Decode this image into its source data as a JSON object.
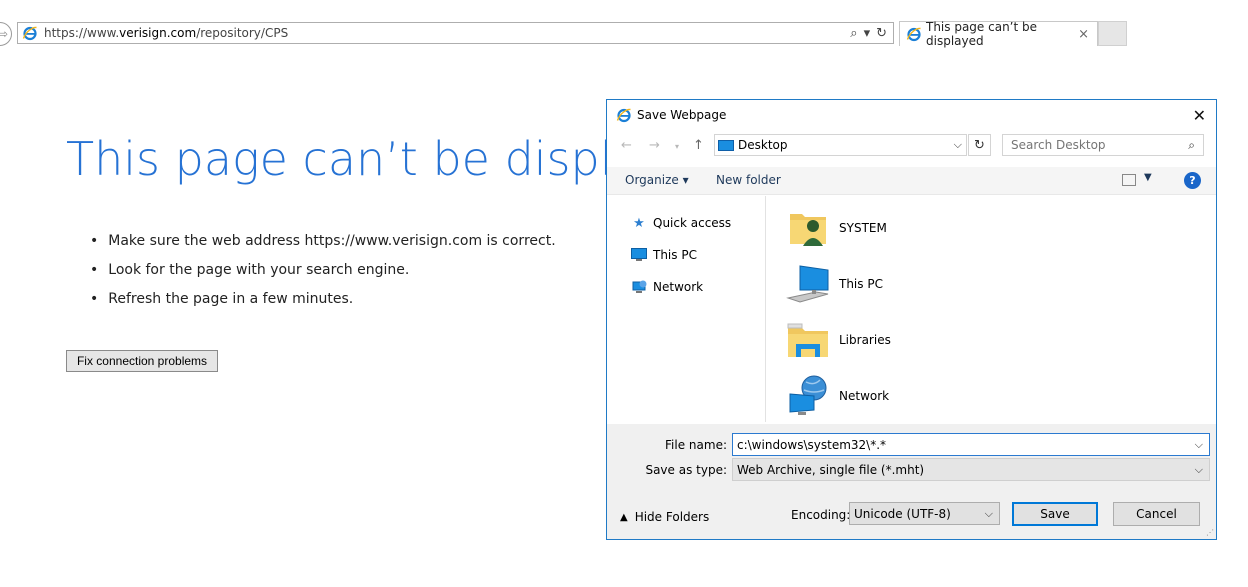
{
  "browser": {
    "address_prefix": "https://www.",
    "address_domain": "verisign.com",
    "address_suffix": "/repository/CPS",
    "search_icon": "⌕",
    "dropdown_icon": "▾",
    "refresh_icon": "↻",
    "tab_title": "This page can’t be displayed",
    "tab_close": "×"
  },
  "error_page": {
    "title": "This page can’t be displayed",
    "bullets": [
      "Make sure the web address https://www.verisign.com is correct.",
      "Look for the page with your search engine.",
      "Refresh the page in a few minutes."
    ],
    "fix_button": "Fix connection problems"
  },
  "dialog": {
    "title": "Save Webpage",
    "close": "✕",
    "location": "Desktop",
    "search_placeholder": "Search Desktop",
    "organize": "Organize ▾",
    "new_folder": "New folder",
    "help": "?",
    "nav_items": [
      {
        "label": "Quick access",
        "icon": "star-icon"
      },
      {
        "label": "This PC",
        "icon": "computer-icon"
      },
      {
        "label": "Network",
        "icon": "network-icon"
      }
    ],
    "items": [
      {
        "label": "SYSTEM",
        "icon": "user-folder-icon"
      },
      {
        "label": "This PC",
        "icon": "computer-icon"
      },
      {
        "label": "Libraries",
        "icon": "libraries-icon"
      },
      {
        "label": "Network",
        "icon": "network-globe-icon"
      }
    ],
    "file_name_label": "File name:",
    "file_name_value": "c:\\windows\\system32\\*.*",
    "save_as_type_label": "Save as type:",
    "save_as_type_value": "Web Archive, single file (*.mht)",
    "hide_folders": "Hide Folders",
    "encoding_label": "Encoding:",
    "encoding_value": "Unicode (UTF-8)",
    "save_button": "Save",
    "cancel_button": "Cancel"
  },
  "colors": {
    "accent": "#2672d4",
    "dialog_border": "#1f7ac6"
  }
}
